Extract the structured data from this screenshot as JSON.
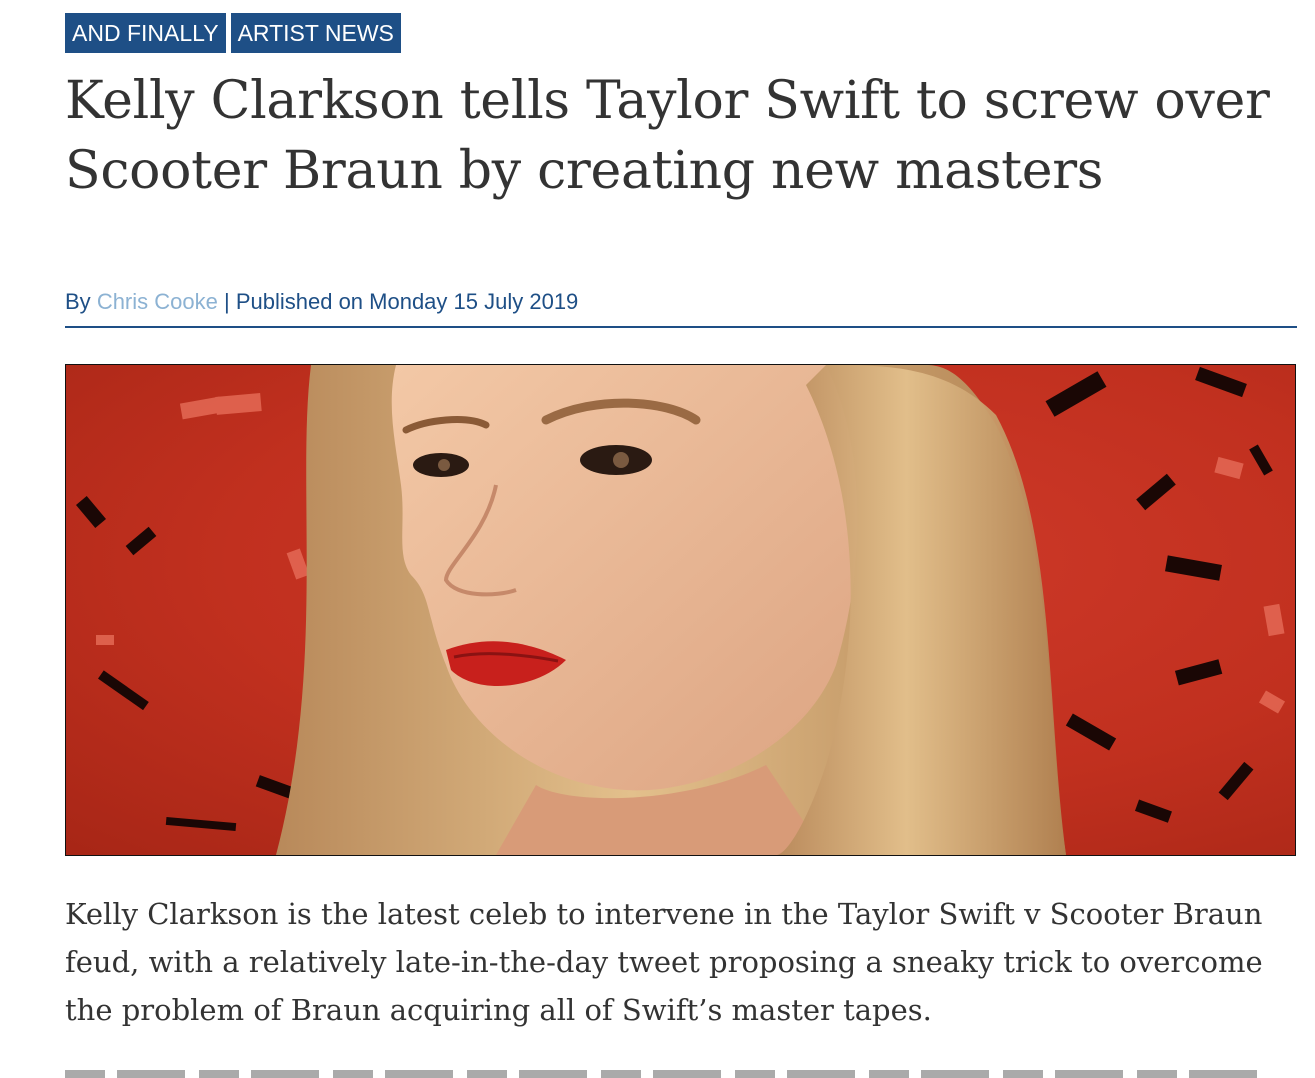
{
  "tags": [
    "AND FINALLY",
    "ARTIST NEWS"
  ],
  "headline": "Kelly Clarkson tells Taylor Swift to screw over Scooter Braun by creating new masters",
  "byline": {
    "prefix": "By",
    "author": "Chris Cooke",
    "separator": "|",
    "published": "Published on Monday 15 July 2019"
  },
  "hero_image": {
    "subject": "Kelly Clarkson portrait on red background with falling confetti"
  },
  "lead_paragraph": "Kelly Clarkson is the latest celeb to intervene in the Taylor Swift v Scooter Braun feud, with a relatively late-in-the-day tweet proposing a sneaky trick to overcome the problem of Braun acquiring all of Swift’s master tapes.",
  "colors": {
    "tag_bg": "#1e4f86",
    "byline": "#1e4f86",
    "author_link": "#8cb2d3",
    "headline": "#333333",
    "hero_bg": "#c1301f"
  }
}
